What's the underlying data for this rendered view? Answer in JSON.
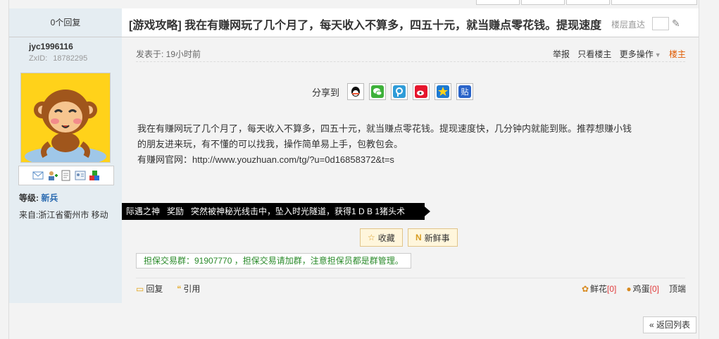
{
  "thread": {
    "reply_count": "0个回复",
    "title": "[游戏攻略] 我在有赚网玩了几个月了，每天收入不算多，四五十元，就当赚点零花钱。提现速度",
    "jump_label": "楼层直达"
  },
  "author": {
    "name": "jyc1996116",
    "zxid_label": "ZxID:",
    "zxid": "18782295",
    "level_label": "等级:",
    "level": "新兵",
    "from": "来自:浙江省衢州市 移动"
  },
  "post": {
    "posted_label": "发表于: 19小时前",
    "actions": [
      "举报",
      "只看楼主",
      "更多操作"
    ],
    "op_label": "楼主",
    "share_label": "分享到",
    "share_icons": [
      "qq-icon",
      "wechat-icon",
      "qzone-icon",
      "weibo-icon",
      "star-icon",
      "tieba-icon"
    ],
    "content_line1": "我在有赚网玩了几个月了，每天收入不算多，四五十元，就当赚点零花钱。提现速度快，几分钟内就能到账。推荐想赚小钱",
    "content_line2": "的朋友进来玩，有不懂的可以找我，操作简单易上手，包教包会。",
    "content_line3": "有赚网官网：http://www.youzhuan.com/tg/?u=0d16858372&t=s",
    "banner_tag": "际遇之神",
    "banner_award": "奖励",
    "banner_text": "突然被神秘光线击中，坠入时光隧道，获得1 D B 1猪头术",
    "collect_label": "收藏",
    "news_label": "新鲜事",
    "guarantee_text": "担保交易群：91907770 ，担保交易请加群，注意担保员都是群管理。"
  },
  "footer": {
    "reply_label": "回复",
    "quote_label": "引用",
    "flower_label": "鲜花",
    "flower_count": "[0]",
    "egg_label": "鸡蛋",
    "egg_count": "[0]",
    "top_label": "顶端"
  },
  "nav": {
    "back_label": "« 返回列表"
  }
}
